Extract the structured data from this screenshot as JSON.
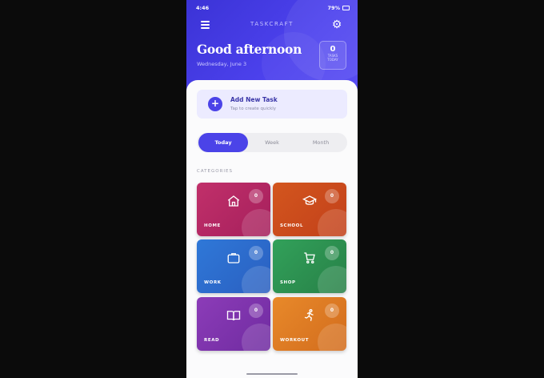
{
  "status_bar": {
    "time": "4:46",
    "battery": "79%"
  },
  "header": {
    "app_title": "TASKCRAFT",
    "greeting": "Good afternoon",
    "date": "Wednesday, June 3",
    "tasks_count": "0",
    "tasks_label_1": "TASKS",
    "tasks_label_2": "TODAY"
  },
  "add_task": {
    "title": "Add New Task",
    "subtitle": "Tap to create quickly",
    "icon": "+"
  },
  "tabs": [
    {
      "label": "Today",
      "active": true
    },
    {
      "label": "Week",
      "active": false
    },
    {
      "label": "Month",
      "active": false
    }
  ],
  "categories_title": "CATEGORIES",
  "categories": [
    {
      "name": "HOME",
      "count": "0",
      "icon": "house-icon",
      "color": "#c1306a"
    },
    {
      "name": "SCHOOL",
      "count": "0",
      "icon": "graduation-cap-icon",
      "color": "#d3561e"
    },
    {
      "name": "WORK",
      "count": "0",
      "icon": "briefcase-icon",
      "color": "#2f6fd0"
    },
    {
      "name": "SHOP",
      "count": "0",
      "icon": "cart-icon",
      "color": "#2f9653"
    },
    {
      "name": "READ",
      "count": "0",
      "icon": "book-icon",
      "color": "#8336b0"
    },
    {
      "name": "WORKOUT",
      "count": "0",
      "icon": "running-icon",
      "color": "#e07f25"
    }
  ],
  "colors": {
    "primary": "#4b43e8",
    "background": "#0b0b0b"
  }
}
